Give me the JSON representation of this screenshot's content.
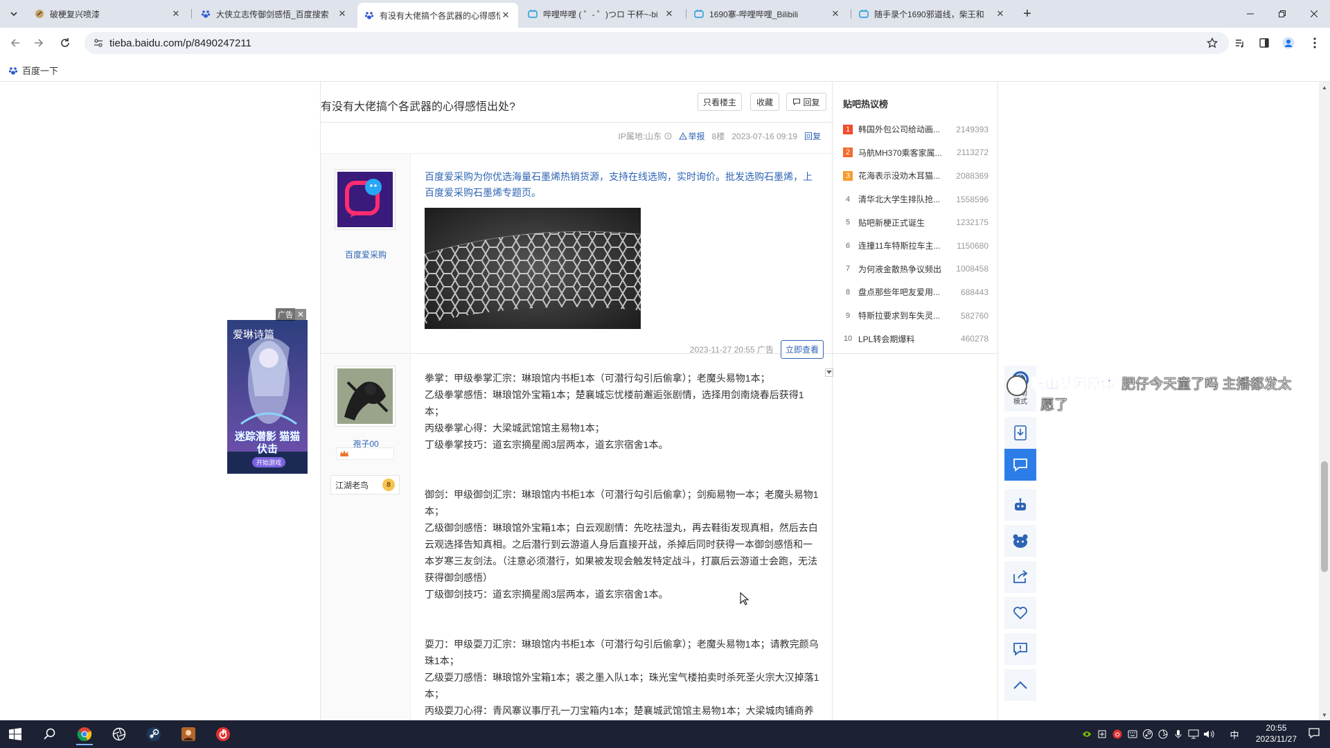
{
  "browser": {
    "tabs": [
      {
        "title": "破梗复兴喷漆",
        "active": false
      },
      {
        "title": "大侠立志传御剑感悟_百度搜索",
        "active": false
      },
      {
        "title": "有没有大佬搞个各武器的心得感悟",
        "active": true
      },
      {
        "title": "哔哩哔哩 ( ゜- ゜)つロ 干杯~-bi",
        "active": false
      },
      {
        "title": "1690寨-哔哩哔哩_Bilibili",
        "active": false
      },
      {
        "title": "随手录个1690邪道线，柴王和",
        "active": false
      }
    ],
    "url": "tieba.baidu.com/p/8490247211",
    "bookmark": "百度一下"
  },
  "thread": {
    "title": "有没有大佬搞个各武器的心得感悟出处?",
    "buttons": {
      "only_op": "只看楼主",
      "favorite": "收藏",
      "reply": "回复"
    }
  },
  "post_meta": {
    "ip": "IP属地:山东",
    "report": "举报",
    "floor": "8楼",
    "time": "2023-07-16 09:19",
    "reply": "回复"
  },
  "ad_post": {
    "username": "百度爱采购",
    "text": "百度爱采购为你优选海量石墨烯热销货源，支持在线选购，实时询价。批发选购石墨烯，上百度爱采购石墨烯专题页。",
    "time": "2023-11-27 20:55",
    "ad_label": "广告",
    "cta": "立即查看"
  },
  "post": {
    "username": "孢子00",
    "level_name": "江湖老鸟",
    "level": "8",
    "paragraphs": [
      [
        "拳掌：甲级拳掌汇宗：琳琅馆内书柜1本（可潜行勾引后偷拿）；老魔头易物1本；",
        "乙级拳掌感悟：琳琅馆外宝箱1本；楚襄城忘忧楼前邂逅张剧情，选择用剑南烧春后获得1本；",
        "丙级拳掌心得：大梁城武馆馆主易物1本；",
        "丁级拳掌技巧：道玄宗摘星阁3层两本，道玄宗宿舍1本。"
      ],
      [
        "御剑：甲级御剑汇宗：琳琅馆内书柜1本（可潜行勾引后偷拿）；剑痴易物一本；老魔头易物1本；",
        "乙级御剑感悟：琳琅馆外宝箱1本；白云观剧情：先吃祛湿丸，再去鞋街发现真相，然后去白云观选择告知真相。之后潜行到云游道人身后直接开战，杀掉后同时获得一本御剑感悟和一本岁寒三友剑法。（注意必须潜行，如果被发现会触发特定战斗，打赢后云游道士会跑，无法获得御剑感悟）",
        "丁级御剑技巧：道玄宗摘星阁3层两本，道玄宗宿舍1本。"
      ],
      [
        "耍刀：甲级耍刀汇宗：琳琅馆内书柜1本（可潜行勾引后偷拿）；老魔头易物1本；请教完颜乌珠1本；",
        "乙级耍刀感悟：琳琅馆外宝箱1本；裘之墨入队1本；珠光宝气楼拍卖时杀死圣火宗大汉掉落1本；",
        "丙级耍刀心得：青风寨议事厅孔一刀宝箱内1本；楚襄城武馆馆主易物1本；大梁城肉铺商养"
      ]
    ]
  },
  "side_ad": {
    "tag": "广告",
    "title": "爱琳诗篇",
    "slogan": "迷踪潜影 猫猫伏击",
    "button": "开始游戏"
  },
  "hot": {
    "title": "贴吧热议榜",
    "items": [
      {
        "rank": "1",
        "name": "韩国外包公司给动画...",
        "count": "2149393"
      },
      {
        "rank": "2",
        "name": "马航MH370乘客家属...",
        "count": "2113272"
      },
      {
        "rank": "3",
        "name": "花海表示没劝木耳猫...",
        "count": "2088369"
      },
      {
        "rank": "4",
        "name": "清华北大学生排队抢...",
        "count": "1558596"
      },
      {
        "rank": "5",
        "name": "贴吧新梗正式诞生",
        "count": "1232175"
      },
      {
        "rank": "6",
        "name": "连撞11车特斯拉车主...",
        "count": "1150680"
      },
      {
        "rank": "7",
        "name": "为何液金散热争议频出",
        "count": "1008458"
      },
      {
        "rank": "8",
        "name": "盘点那些年吧友爱用...",
        "count": "688443"
      },
      {
        "rank": "9",
        "name": "特斯拉要求到车失灵...",
        "count": "582760"
      },
      {
        "rank": "10",
        "name": "LPL转会期爆料",
        "count": "460278"
      }
    ]
  },
  "rail": {
    "assist_label": "辅助\n模式"
  },
  "danmaku": {
    "name": "鞍山基因原体",
    "message": "肥仔今天童了吗 主播都发太",
    "message2": "愿了"
  },
  "taskbar": {
    "time": "20:55",
    "date": "2023/11/27",
    "ime": "中"
  },
  "colors": {
    "link": "#2d64b3",
    "hot_top": "#f24c27",
    "taskbar": "#1c2233",
    "tabstrip": "#dfe3eb"
  }
}
